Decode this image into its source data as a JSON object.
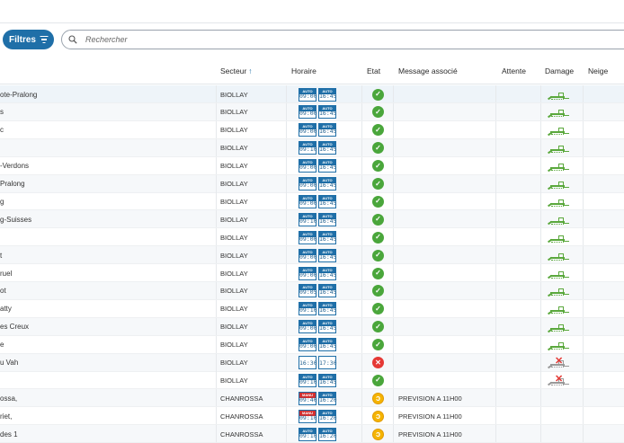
{
  "filters": {
    "label": "Filtres"
  },
  "search": {
    "placeholder": "Rechercher"
  },
  "columns": {
    "secteur": "Secteur",
    "horaire": "Horaire",
    "etat": "Etat",
    "message": "Message associé",
    "attente": "Attente",
    "damage": "Damage",
    "neige": "Neige"
  },
  "colors": {
    "accent": "#1f6fa8",
    "ok": "#4aa63b",
    "closed": "#e53935",
    "warning": "#f5b400",
    "manual_tag": "#d32f2f"
  },
  "rows": [
    {
      "name": "ote-Pralong",
      "sector": "BIOLLAY",
      "tag1": "AUTO",
      "t1": "09:00",
      "tag2": "AUTO",
      "t2": "16:45",
      "state": "open",
      "message": "",
      "damage": "groomed"
    },
    {
      "name": "s",
      "sector": "BIOLLAY",
      "tag1": "AUTO",
      "t1": "09:00",
      "tag2": "AUTO",
      "t2": "16:45",
      "state": "open",
      "message": "",
      "damage": "groomed"
    },
    {
      "name": "c",
      "sector": "BIOLLAY",
      "tag1": "AUTO",
      "t1": "09:00",
      "tag2": "AUTO",
      "t2": "16:45",
      "state": "open",
      "message": "",
      "damage": "groomed"
    },
    {
      "name": "",
      "sector": "BIOLLAY",
      "tag1": "AUTO",
      "t1": "09:10",
      "tag2": "AUTO",
      "t2": "16:45",
      "state": "open",
      "message": "",
      "damage": "groomed"
    },
    {
      "name": "-Verdons",
      "sector": "BIOLLAY",
      "tag1": "AUTO",
      "t1": "09:00",
      "tag2": "AUTO",
      "t2": "16:45",
      "state": "open",
      "message": "",
      "damage": "groomed"
    },
    {
      "name": "Pralong",
      "sector": "BIOLLAY",
      "tag1": "AUTO",
      "t1": "09:00",
      "tag2": "AUTO",
      "t2": "16:45",
      "state": "open",
      "message": "",
      "damage": "groomed"
    },
    {
      "name": "g",
      "sector": "BIOLLAY",
      "tag1": "AUTO",
      "t1": "09:00",
      "tag2": "AUTO",
      "t2": "16:45",
      "state": "open",
      "message": "",
      "damage": "groomed"
    },
    {
      "name": "g-Suisses",
      "sector": "BIOLLAY",
      "tag1": "AUTO",
      "t1": "09:10",
      "tag2": "AUTO",
      "t2": "16:45",
      "state": "open",
      "message": "",
      "damage": "groomed"
    },
    {
      "name": "",
      "sector": "BIOLLAY",
      "tag1": "AUTO",
      "t1": "09:00",
      "tag2": "AUTO",
      "t2": "16:45",
      "state": "open",
      "message": "",
      "damage": "groomed"
    },
    {
      "name": "t",
      "sector": "BIOLLAY",
      "tag1": "AUTO",
      "t1": "09:00",
      "tag2": "AUTO",
      "t2": "16:45",
      "state": "open",
      "message": "",
      "damage": "groomed"
    },
    {
      "name": "ruel",
      "sector": "BIOLLAY",
      "tag1": "AUTO",
      "t1": "09:00",
      "tag2": "AUTO",
      "t2": "16:45",
      "state": "open",
      "message": "",
      "damage": "groomed"
    },
    {
      "name": "ot",
      "sector": "BIOLLAY",
      "tag1": "AUTO",
      "t1": "09:05",
      "tag2": "AUTO",
      "t2": "16:45",
      "state": "open",
      "message": "",
      "damage": "groomed"
    },
    {
      "name": "atty",
      "sector": "BIOLLAY",
      "tag1": "AUTO",
      "t1": "09:10",
      "tag2": "AUTO",
      "t2": "16:45",
      "state": "open",
      "message": "",
      "damage": "groomed"
    },
    {
      "name": "es Creux",
      "sector": "BIOLLAY",
      "tag1": "AUTO",
      "t1": "09:00",
      "tag2": "AUTO",
      "t2": "16:45",
      "state": "open",
      "message": "",
      "damage": "groomed"
    },
    {
      "name": "e",
      "sector": "BIOLLAY",
      "tag1": "AUTO",
      "t1": "09:00",
      "tag2": "AUTO",
      "t2": "16:45",
      "state": "open",
      "message": "",
      "damage": "groomed"
    },
    {
      "name": "u Vah",
      "sector": "BIOLLAY",
      "tag1": "",
      "t1": "16:30",
      "tag2": "",
      "t2": "17:30",
      "state": "closed",
      "message": "",
      "damage": "not-groomed"
    },
    {
      "name": "",
      "sector": "BIOLLAY",
      "tag1": "AUTO",
      "t1": "09:10",
      "tag2": "AUTO",
      "t2": "16:45",
      "state": "open",
      "message": "",
      "damage": "not-groomed"
    },
    {
      "name": "ossa,",
      "sector": "CHANROSSA",
      "tag1": "MANU",
      "t1": "09:40",
      "tag2": "AUTO",
      "t2": "16:20",
      "state": "waiting",
      "message": "PREVISION A 11H00",
      "damage": "none"
    },
    {
      "name": "riet,",
      "sector": "CHANROSSA",
      "tag1": "MANU",
      "t1": "09:10",
      "tag2": "AUTO",
      "t2": "16:20",
      "state": "waiting",
      "message": "PREVISION A 11H00",
      "damage": "none"
    },
    {
      "name": "des 1",
      "sector": "CHANROSSA",
      "tag1": "AUTO",
      "t1": "09:10",
      "tag2": "AUTO",
      "t2": "16:20",
      "state": "waiting",
      "message": "PREVISION A 11H00",
      "damage": "none"
    }
  ]
}
